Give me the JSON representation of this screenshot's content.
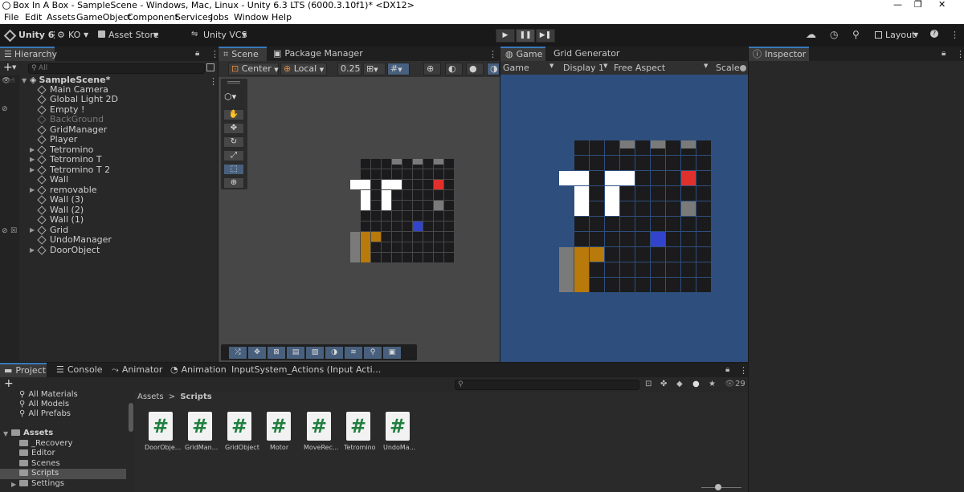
{
  "window": {
    "title": "Box In A Box - SampleScene - Windows, Mac, Linux - Unity 6.3 LTS (6000.3.10f1)* <DX12>",
    "minimize": "—",
    "restore": "❐",
    "close": "✕"
  },
  "menu": [
    "File",
    "Edit",
    "Assets",
    "GameObject",
    "Component",
    "Services",
    "Jobs",
    "Window",
    "Help"
  ],
  "toolbar": {
    "unity": "Unity 6",
    "account": "KO",
    "asset_store": "Asset Store",
    "vcs": "Unity VCS",
    "layout": "Layout",
    "play": "▶",
    "pause": "❚❚",
    "step": "▶❚"
  },
  "hierarchy": {
    "tab": "Hierarchy",
    "search_placeholder": "All",
    "scene": "SampleScene*",
    "items": [
      {
        "label": "Main Camera"
      },
      {
        "label": "Global Light 2D"
      },
      {
        "label": "Empty !"
      },
      {
        "label": "BackGround"
      },
      {
        "label": "GridManager"
      },
      {
        "label": "Player"
      },
      {
        "label": "Tetromino"
      },
      {
        "label": "Tetromino  T"
      },
      {
        "label": "Tetromino  T 2"
      },
      {
        "label": "Wall"
      },
      {
        "label": "removable"
      },
      {
        "label": "Wall (3)"
      },
      {
        "label": "Wall (2)"
      },
      {
        "label": "Wall (1)"
      },
      {
        "label": "Grid"
      },
      {
        "label": "UndoManager"
      },
      {
        "label": "DoorObject"
      }
    ]
  },
  "scene": {
    "tabs": [
      "Scene",
      "Package Manager"
    ],
    "pivot": "Center",
    "space": "Local",
    "snap": "0.25"
  },
  "game": {
    "tabs": [
      "Game",
      "Grid Generator"
    ],
    "mode": "Game",
    "display": "Display 1",
    "aspect": "Free Aspect",
    "scale": "Scale"
  },
  "inspector": {
    "tab": "Inspector"
  },
  "project": {
    "tabs": [
      "Project",
      "Console",
      "Animator",
      "Animation",
      "InputSystem_Actions (Input Acti..."
    ],
    "count": "29",
    "breadcrumb_root": "Assets",
    "breadcrumb_sep": ">",
    "breadcrumb_leaf": "Scripts",
    "favorites": [
      "All Materials",
      "All Models",
      "All Prefabs"
    ],
    "assets_root": "Assets",
    "folders": [
      "_Recovery",
      "Editor",
      "Scenes",
      "Scripts",
      "Settings"
    ],
    "scripts": [
      "DoorObje...",
      "GridMan...",
      "GridObject",
      "Motor",
      "MoveRec...",
      "Tetromino",
      "UndoMa..."
    ],
    "script_glyph": "#"
  },
  "colors": {
    "accent": "#3a79bb",
    "game_bg": "#2e4f7d",
    "cell": "#1b1b1d",
    "wall": "#7a7a7a",
    "red": "#e0302c",
    "blue": "#3344cc",
    "orange": "#b87a0a",
    "white": "#ffffff"
  }
}
